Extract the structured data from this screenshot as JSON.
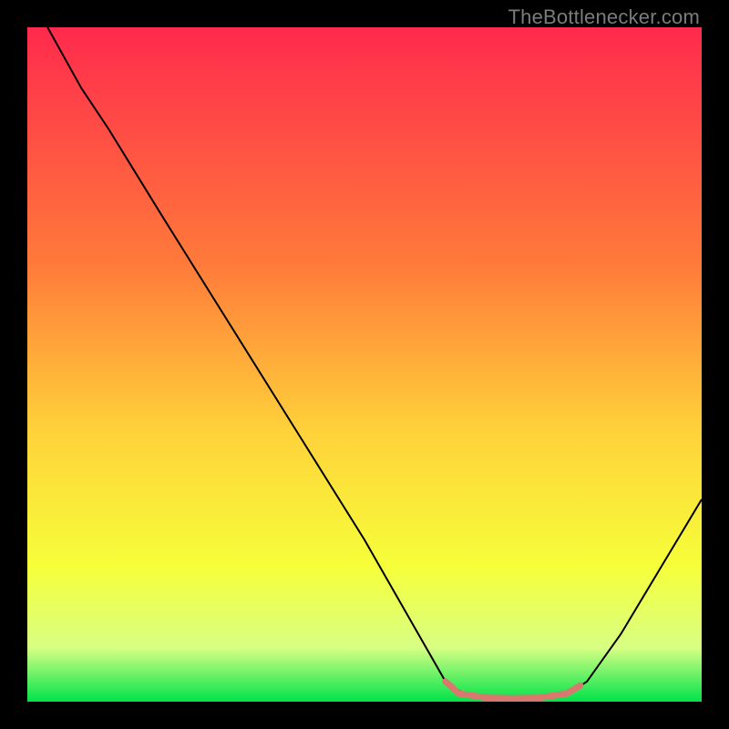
{
  "watermark": "TheBottlenecker.com",
  "chart_data": {
    "type": "line",
    "title": "",
    "xlabel": "",
    "ylabel": "",
    "xlim": [
      0,
      100
    ],
    "ylim": [
      0,
      100
    ],
    "gradient_stops": [
      {
        "offset": 0,
        "color": "#ff2a4d"
      },
      {
        "offset": 35,
        "color": "#ff7a3a"
      },
      {
        "offset": 60,
        "color": "#ffd23a"
      },
      {
        "offset": 80,
        "color": "#f6ff3a"
      },
      {
        "offset": 92,
        "color": "#d8ff84"
      },
      {
        "offset": 100,
        "color": "#00e34a"
      }
    ],
    "series": [
      {
        "name": "bottleneck-curve",
        "stroke": "#000000",
        "stroke_width": 2,
        "points": [
          {
            "x": 3,
            "y": 100
          },
          {
            "x": 8,
            "y": 91
          },
          {
            "x": 12,
            "y": 85
          },
          {
            "x": 20,
            "y": 72
          },
          {
            "x": 30,
            "y": 56
          },
          {
            "x": 40,
            "y": 40
          },
          {
            "x": 50,
            "y": 24
          },
          {
            "x": 58,
            "y": 10
          },
          {
            "x": 62,
            "y": 3
          },
          {
            "x": 65,
            "y": 1
          },
          {
            "x": 70,
            "y": 0.5
          },
          {
            "x": 75,
            "y": 0.5
          },
          {
            "x": 80,
            "y": 1
          },
          {
            "x": 83,
            "y": 3
          },
          {
            "x": 88,
            "y": 10
          },
          {
            "x": 94,
            "y": 20
          },
          {
            "x": 100,
            "y": 30
          }
        ]
      },
      {
        "name": "optimal-band",
        "stroke": "#d9786f",
        "stroke_width": 7,
        "points": [
          {
            "x": 62,
            "y": 3
          },
          {
            "x": 64,
            "y": 1.2
          },
          {
            "x": 68,
            "y": 0.6
          },
          {
            "x": 72,
            "y": 0.5
          },
          {
            "x": 76,
            "y": 0.6
          },
          {
            "x": 80,
            "y": 1.2
          },
          {
            "x": 82,
            "y": 2.4
          }
        ]
      }
    ]
  }
}
